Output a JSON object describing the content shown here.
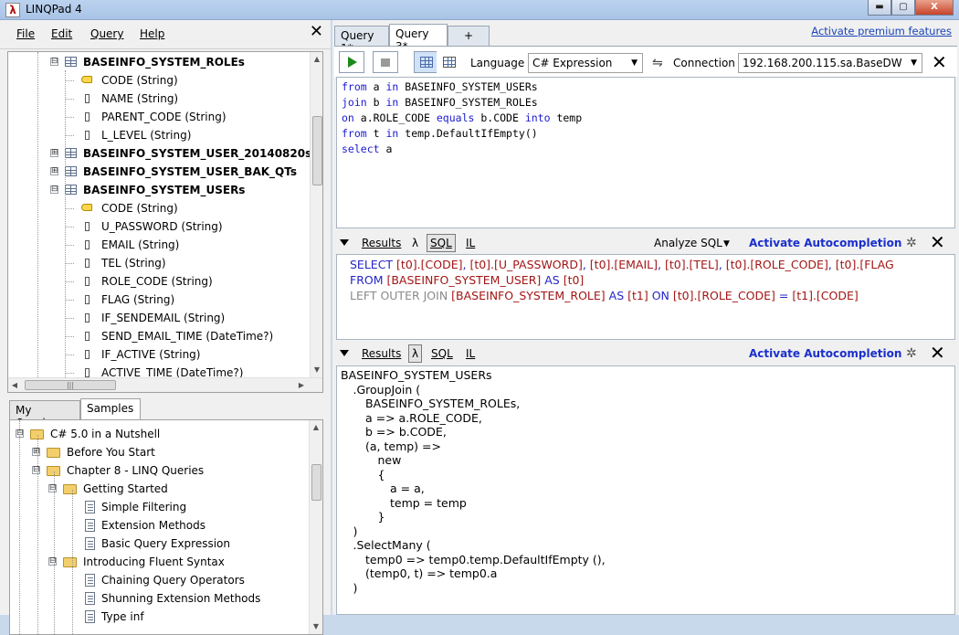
{
  "window": {
    "title": "LINQPad 4",
    "app_icon": "λ",
    "controls": {
      "minimize": "▬",
      "maximize": "▢",
      "close": "X"
    }
  },
  "menu": {
    "file": "File",
    "edit": "Edit",
    "query": "Query",
    "help": "Help",
    "close": "✕"
  },
  "schema_tree": {
    "items": [
      {
        "text": "BASEINFO_SYSTEM_ROLEs",
        "icon": "table-icon",
        "bold": true,
        "expander": "⊟"
      },
      {
        "text": "CODE (String)",
        "icon": "key-icon"
      },
      {
        "text": "NAME (String)",
        "icon": "column-icon"
      },
      {
        "text": "PARENT_CODE (String)",
        "icon": "column-icon"
      },
      {
        "text": "L_LEVEL (String)",
        "icon": "column-icon"
      },
      {
        "text": "BASEINFO_SYSTEM_USER_20140820s",
        "icon": "table-icon",
        "bold": true,
        "expander": "⊞"
      },
      {
        "text": "BASEINFO_SYSTEM_USER_BAK_QTs",
        "icon": "table-icon",
        "bold": true,
        "expander": "⊞"
      },
      {
        "text": "BASEINFO_SYSTEM_USERs",
        "icon": "table-icon",
        "bold": true,
        "expander": "⊟"
      },
      {
        "text": "CODE (String)",
        "icon": "key-icon"
      },
      {
        "text": "U_PASSWORD (String)",
        "icon": "column-icon"
      },
      {
        "text": "EMAIL (String)",
        "icon": "column-icon"
      },
      {
        "text": "TEL (String)",
        "icon": "column-icon"
      },
      {
        "text": "ROLE_CODE (String)",
        "icon": "column-icon"
      },
      {
        "text": "FLAG (String)",
        "icon": "column-icon"
      },
      {
        "text": "IF_SENDEMAIL (String)",
        "icon": "column-icon"
      },
      {
        "text": "SEND_EMAIL_TIME (DateTime?)",
        "icon": "column-icon"
      },
      {
        "text": "IF_ACTIVE (String)",
        "icon": "column-icon"
      },
      {
        "text": "ACTIVE_TIME (DateTime?)",
        "icon": "column-icon"
      }
    ]
  },
  "sample_tabs": {
    "my_queries": "My Queries",
    "samples": "Samples"
  },
  "samples_tree": {
    "items": [
      {
        "text": "C# 5.0 in a Nutshell",
        "icon": "folder-icon",
        "expander": "⊟"
      },
      {
        "text": "Before You Start",
        "icon": "folder-icon",
        "expander": "⊞"
      },
      {
        "text": "Chapter 8 - LINQ Queries",
        "icon": "folder-icon",
        "expander": "⊟"
      },
      {
        "text": "Getting Started",
        "icon": "folder-icon",
        "expander": "⊟"
      },
      {
        "text": "Simple Filtering",
        "icon": "document-icon"
      },
      {
        "text": "Extension Methods",
        "icon": "document-icon"
      },
      {
        "text": "Basic Query Expression",
        "icon": "document-icon"
      },
      {
        "text": "Introducing Fluent Syntax",
        "icon": "folder-icon",
        "expander": "⊟"
      },
      {
        "text": "Chaining Query Operators",
        "icon": "document-icon"
      },
      {
        "text": "Shunning Extension Methods",
        "icon": "document-icon"
      },
      {
        "text": "Type inf",
        "icon": "document-icon"
      }
    ]
  },
  "query_tabs": {
    "tab1": "Query 1*",
    "tab2": "Query 3*",
    "add": "+"
  },
  "premium_link": "Activate premium features",
  "toolbar": {
    "language_label": "Language",
    "language_value": "C# Expression",
    "connection_label": "Connection",
    "connection_value": "192.168.200.115.sa.BaseDW",
    "close": "✕",
    "dropdown_arrow": "▼",
    "plug": "⇋"
  },
  "editor": {
    "lines": [
      [
        {
          "t": "from",
          "k": true
        },
        {
          "t": " a "
        },
        {
          "t": "in",
          "k": true
        },
        {
          "t": " BASEINFO_SYSTEM_USERs"
        }
      ],
      [
        {
          "t": "join",
          "k": true
        },
        {
          "t": " b "
        },
        {
          "t": "in",
          "k": true
        },
        {
          "t": " BASEINFO_SYSTEM_ROLEs"
        }
      ],
      [
        {
          "t": "on",
          "k": true
        },
        {
          "t": " a.ROLE_CODE "
        },
        {
          "t": "equals",
          "k": true
        },
        {
          "t": " b.CODE "
        },
        {
          "t": "into",
          "k": true
        },
        {
          "t": " temp"
        }
      ],
      [
        {
          "t": "from",
          "k": true
        },
        {
          "t": " t "
        },
        {
          "t": "in",
          "k": true
        },
        {
          "t": " temp.DefaultIfEmpty()"
        }
      ],
      [
        {
          "t": "select",
          "k": true
        },
        {
          "t": " a"
        }
      ]
    ]
  },
  "sql_pane": {
    "results": "Results",
    "lambda": "λ",
    "sql": "SQL",
    "il": "IL",
    "analyze": "Analyze SQL",
    "analyze_arrow": "▼",
    "autocompletion": "Activate Autocompletion",
    "spinner": "✲",
    "close": "✕",
    "lines": [
      [
        {
          "t": "SELECT ",
          "c": "skw"
        },
        {
          "t": "[t0].[CODE]",
          "c": "sid"
        },
        {
          "t": ", ",
          "c": "skw"
        },
        {
          "t": "[t0].[U_PASSWORD]",
          "c": "sid"
        },
        {
          "t": ", ",
          "c": "skw"
        },
        {
          "t": "[t0].[EMAIL]",
          "c": "sid"
        },
        {
          "t": ", ",
          "c": "skw"
        },
        {
          "t": "[t0].[TEL]",
          "c": "sid"
        },
        {
          "t": ", ",
          "c": "skw"
        },
        {
          "t": "[t0].[ROLE_CODE]",
          "c": "sid"
        },
        {
          "t": ", ",
          "c": "skw"
        },
        {
          "t": "[t0].[FLAG",
          "c": "sid"
        }
      ],
      [
        {
          "t": "FROM ",
          "c": "skw"
        },
        {
          "t": "[BASEINFO_SYSTEM_USER]",
          "c": "sid"
        },
        {
          "t": " AS ",
          "c": "skw"
        },
        {
          "t": "[t0]",
          "c": "sid"
        }
      ],
      [
        {
          "t": "LEFT OUTER JOIN ",
          "c": "skw-grey"
        },
        {
          "t": "[BASEINFO_SYSTEM_ROLE]",
          "c": "sid"
        },
        {
          "t": " AS ",
          "c": "skw"
        },
        {
          "t": "[t1]",
          "c": "sid"
        },
        {
          "t": " ON ",
          "c": "skw"
        },
        {
          "t": "[t0].[ROLE_CODE]",
          "c": "sid"
        },
        {
          "t": " = ",
          "c": "skw"
        },
        {
          "t": "[t1].[CODE]",
          "c": "sid"
        }
      ]
    ]
  },
  "lambda_pane": {
    "results": "Results",
    "lambda": "λ",
    "sql": "SQL",
    "il": "IL",
    "autocompletion": "Activate Autocompletion",
    "spinner": "✲",
    "close": "✕",
    "lines": [
      {
        "t": "BASEINFO_SYSTEM_USERs",
        "i": 0
      },
      {
        "t": ".GroupJoin (",
        "i": 1
      },
      {
        "t": "BASEINFO_SYSTEM_ROLEs,",
        "i": 2
      },
      {
        "t": "a => a.ROLE_CODE,",
        "i": 2
      },
      {
        "t": "b => b.CODE,",
        "i": 2
      },
      {
        "t": "(a, temp) =>",
        "i": 2
      },
      {
        "t": "new",
        "i": 3
      },
      {
        "t": "{",
        "i": 3
      },
      {
        "t": "a = a,",
        "i": 4
      },
      {
        "t": "temp = temp",
        "i": 4
      },
      {
        "t": "}",
        "i": 3
      },
      {
        "t": ")",
        "i": 1
      },
      {
        "t": ".SelectMany (",
        "i": 1
      },
      {
        "t": "temp0 => temp0.temp.DefaultIfEmpty (),",
        "i": 2
      },
      {
        "t": "(temp0, t) => temp0.a",
        "i": 2
      },
      {
        "t": ")",
        "i": 1
      }
    ]
  },
  "colors": {
    "keyword": "#1a1ad0",
    "sql_keyword": "#2424c8",
    "sql_identifier": "#a31515",
    "link": "#1a44b8",
    "run_green": "#1a8a1a"
  }
}
